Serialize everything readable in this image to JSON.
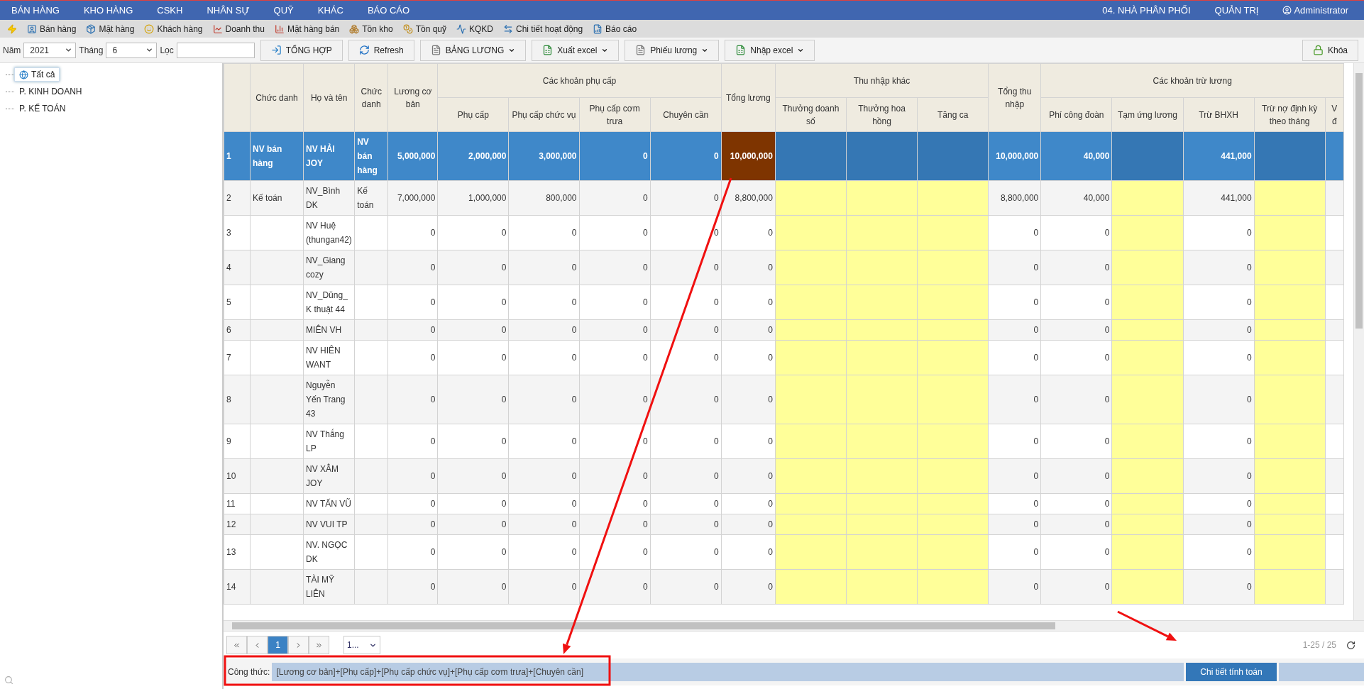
{
  "nav": {
    "left": [
      "BÁN HÀNG",
      "KHO HÀNG",
      "CSKH",
      "NHÂN SỰ",
      "QUỸ",
      "KHÁC",
      "BÁO CÁO"
    ],
    "right": [
      "04. NHÀ PHÂN PHỐI",
      "QUẢN TRỊ"
    ],
    "user": "Administrator"
  },
  "toolbar": [
    "Bán hàng",
    "Mặt hàng",
    "Khách hàng",
    "Doanh thu",
    "Mặt hàng bán",
    "Tồn kho",
    "Tồn quỹ",
    "KQKD",
    "Chi tiết hoạt động",
    "Báo cáo"
  ],
  "filters": {
    "year": {
      "label": "Năm",
      "value": "2021"
    },
    "month": {
      "label": "Tháng",
      "value": "6"
    },
    "search": {
      "label": "Lọc"
    }
  },
  "actions": [
    {
      "label": "TỔNG HỢP",
      "dropdown": false
    },
    {
      "label": "Refresh",
      "dropdown": false
    },
    {
      "label": "BẢNG LƯƠNG",
      "dropdown": true
    },
    {
      "label": "Xuất excel",
      "dropdown": true
    },
    {
      "label": "Phiếu lương",
      "dropdown": true
    },
    {
      "label": "Nhập excel",
      "dropdown": true
    }
  ],
  "lock_button": "Khóa",
  "tree": [
    {
      "label": "Tất cả",
      "selected": true
    },
    {
      "label": "P. KINH DOANH",
      "selected": false
    },
    {
      "label": "P. KẾ TOÁN",
      "selected": false
    }
  ],
  "table": {
    "header": [
      {
        "kind": "index"
      },
      {
        "label": "Chức danh",
        "kind": "text"
      },
      {
        "label": "Họ và tên",
        "kind": "text"
      },
      {
        "label": "Chức danh",
        "kind": "narrow"
      },
      {
        "label": "Lương cơ bản",
        "kind": "number"
      },
      {
        "label": "Các khoản phụ cấp",
        "children": [
          {
            "label": "Phụ cấp",
            "kind": "number"
          },
          {
            "label": "Phụ cấp chức vụ",
            "kind": "number"
          },
          {
            "label": "Phụ cấp cơm trưa",
            "kind": "number"
          },
          {
            "label": "Chuyên cần",
            "kind": "number"
          }
        ]
      },
      {
        "label": "Tổng lương",
        "kind": "formula"
      },
      {
        "label": "Thu nhập khác",
        "children": [
          {
            "label": "Thưởng doanh số",
            "kind": "input"
          },
          {
            "label": "Thưởng hoa hồng",
            "kind": "input"
          },
          {
            "label": "Tăng ca",
            "kind": "input"
          }
        ]
      },
      {
        "label": "Tổng thu nhập",
        "kind": "total"
      },
      {
        "label": "Các khoản trừ lương",
        "children": [
          {
            "label": "Phí công đoàn",
            "kind": "number"
          },
          {
            "label": "Tạm ứng lương",
            "kind": "input"
          },
          {
            "label": "Trừ BHXH",
            "kind": "number"
          },
          {
            "label": "Trừ nợ định kỳ theo tháng",
            "kind": "input"
          },
          {
            "label": "V đ",
            "kind": "cut"
          }
        ]
      }
    ],
    "rows": [
      {
        "selected": true,
        "cells": [
          "1",
          "NV bán hàng",
          "NV HẢI JOY",
          "NV bán hàng",
          "5,000,000",
          "2,000,000",
          "3,000,000",
          "0",
          "0",
          "10,000,000",
          null,
          null,
          null,
          "10,000,000",
          "40,000",
          null,
          "441,000",
          null,
          null
        ]
      },
      {
        "selected": false,
        "cells": [
          "2",
          "Kế toán",
          "NV_Bình DK",
          "Kế toán",
          "7,000,000",
          "1,000,000",
          "800,000",
          "0",
          "0",
          "8,800,000",
          null,
          null,
          null,
          "8,800,000",
          "40,000",
          null,
          "441,000",
          null,
          null
        ]
      },
      {
        "selected": false,
        "cells": [
          "3",
          null,
          "NV Huệ (thungan42)",
          null,
          "0",
          "0",
          "0",
          "0",
          "0",
          "0",
          null,
          null,
          null,
          "0",
          "0",
          null,
          "0",
          null,
          null
        ]
      },
      {
        "selected": false,
        "cells": [
          "4",
          null,
          "NV_Giang cozy",
          null,
          "0",
          "0",
          "0",
          "0",
          "0",
          "0",
          null,
          null,
          null,
          "0",
          "0",
          null,
          "0",
          null,
          null
        ]
      },
      {
        "selected": false,
        "cells": [
          "5",
          null,
          "NV_Dũng_K thuật 44",
          null,
          "0",
          "0",
          "0",
          "0",
          "0",
          "0",
          null,
          null,
          null,
          "0",
          "0",
          null,
          "0",
          null,
          null
        ]
      },
      {
        "selected": false,
        "cells": [
          "6",
          null,
          "MIÊN VH",
          null,
          "0",
          "0",
          "0",
          "0",
          "0",
          "0",
          null,
          null,
          null,
          "0",
          "0",
          null,
          "0",
          null,
          null
        ]
      },
      {
        "selected": false,
        "cells": [
          "7",
          null,
          "NV HIÊN WANT",
          null,
          "0",
          "0",
          "0",
          "0",
          "0",
          "0",
          null,
          null,
          null,
          "0",
          "0",
          null,
          "0",
          null,
          null
        ]
      },
      {
        "selected": false,
        "cells": [
          "8",
          null,
          "Nguyễn Yến Trang 43",
          null,
          "0",
          "0",
          "0",
          "0",
          "0",
          "0",
          null,
          null,
          null,
          "0",
          "0",
          null,
          "0",
          null,
          null
        ]
      },
      {
        "selected": false,
        "cells": [
          "9",
          null,
          "NV Thắng LP",
          null,
          "0",
          "0",
          "0",
          "0",
          "0",
          "0",
          null,
          null,
          null,
          "0",
          "0",
          null,
          "0",
          null,
          null
        ]
      },
      {
        "selected": false,
        "cells": [
          "10",
          null,
          "NV XÂM JOY",
          null,
          "0",
          "0",
          "0",
          "0",
          "0",
          "0",
          null,
          null,
          null,
          "0",
          "0",
          null,
          "0",
          null,
          null
        ]
      },
      {
        "selected": false,
        "cells": [
          "11",
          null,
          "NV TẤN VŨ",
          null,
          "0",
          "0",
          "0",
          "0",
          "0",
          "0",
          null,
          null,
          null,
          "0",
          "0",
          null,
          "0",
          null,
          null
        ]
      },
      {
        "selected": false,
        "cells": [
          "12",
          null,
          "NV VUI TP",
          null,
          "0",
          "0",
          "0",
          "0",
          "0",
          "0",
          null,
          null,
          null,
          "0",
          "0",
          null,
          "0",
          null,
          null
        ]
      },
      {
        "selected": false,
        "cells": [
          "13",
          null,
          "NV. NGỌC DK",
          null,
          "0",
          "0",
          "0",
          "0",
          "0",
          "0",
          null,
          null,
          null,
          "0",
          "0",
          null,
          "0",
          null,
          null
        ]
      },
      {
        "selected": false,
        "cells": [
          "14",
          null,
          "TÀI MỸ LIÊN",
          null,
          "0",
          "0",
          "0",
          "0",
          "0",
          "0",
          null,
          null,
          null,
          "0",
          "0",
          null,
          "0",
          null,
          null
        ]
      }
    ]
  },
  "pager": {
    "pages": [
      {
        "label": "1",
        "selected": true
      }
    ],
    "page_size": "1...",
    "range": "1-25 / 25"
  },
  "formula": {
    "label": "Công thức:",
    "value": "[Lương cơ bản]+[Phụ cấp]+[Phụ cấp chức vụ]+[Phụ cấp cơm trưa]+[Chuyên cần]",
    "button": "Chi tiết tính toán"
  },
  "annotations": [
    {
      "kind": "arrow"
    },
    {
      "kind": "arrow"
    },
    {
      "kind": "frame"
    }
  ]
}
